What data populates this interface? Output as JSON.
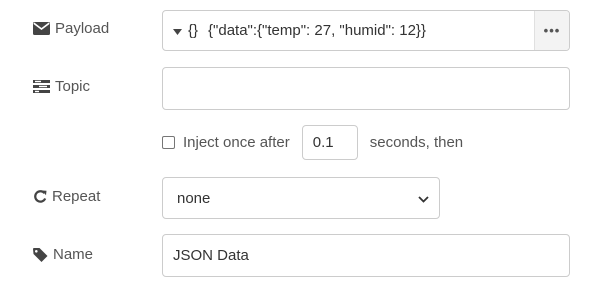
{
  "payload": {
    "label": "Payload",
    "icon": "envelope-icon",
    "type_indicator": "{}",
    "value": "{\"data\":{\"temp\": 27, \"humid\": 12}}",
    "expand_label": "•••"
  },
  "topic": {
    "label": "Topic",
    "icon": "tasks-icon",
    "value": ""
  },
  "inject": {
    "checked": false,
    "prefix": "Inject once after",
    "delay_value": "0.1",
    "suffix": "seconds, then"
  },
  "repeat": {
    "label": "Repeat",
    "icon": "repeat-icon",
    "selected": "none"
  },
  "name": {
    "label": "Name",
    "icon": "tag-icon",
    "value": "JSON Data"
  }
}
